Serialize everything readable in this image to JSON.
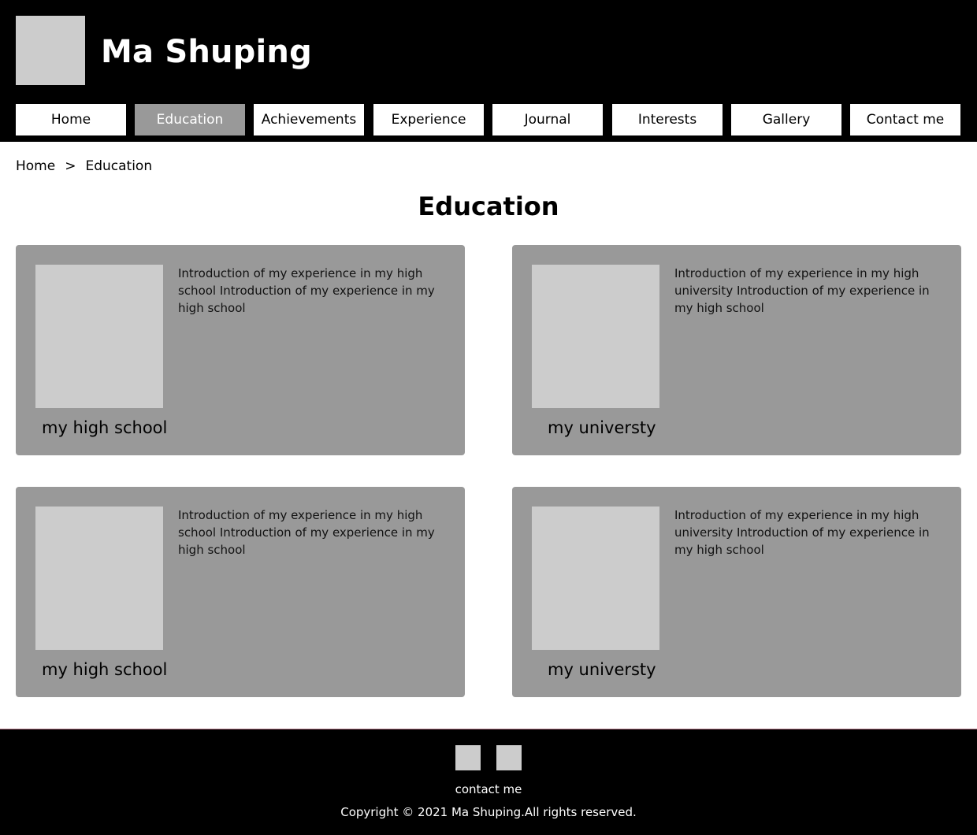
{
  "header": {
    "title": "Ma Shuping"
  },
  "nav": {
    "items": [
      {
        "label": "Home"
      },
      {
        "label": "Education"
      },
      {
        "label": "Achievements"
      },
      {
        "label": "Experience"
      },
      {
        "label": "Journal"
      },
      {
        "label": "Interests"
      },
      {
        "label": "Gallery"
      },
      {
        "label": "Contact me"
      }
    ],
    "active": "Education"
  },
  "breadcrumb": {
    "home": "Home",
    "separator": ">",
    "current": "Education"
  },
  "page": {
    "title": "Education"
  },
  "cards": [
    {
      "text": "Introduction of my experience in my high school Introduction of my experience in my high school",
      "caption": "my high school"
    },
    {
      "text": "Introduction of my experience in my high university Introduction of my experience in my high school",
      "caption": "my universty"
    },
    {
      "text": "Introduction of my experience in my high school Introduction of my experience in my high school",
      "caption": "my high school"
    },
    {
      "text": "Introduction of my experience in my high university Introduction of my experience in my high school",
      "caption": "my universty"
    }
  ],
  "footer": {
    "contact": "contact me",
    "copyright": "Copyright © 2021 Ma Shuping.All rights reserved.",
    "social_icons": [
      "social-icon-1",
      "social-icon-2"
    ]
  },
  "colors": {
    "header_bg": "#000000",
    "nav_active_bg": "#999999",
    "card_bg": "#999999",
    "placeholder": "#cccccc",
    "footer_border": "#a8697c"
  }
}
